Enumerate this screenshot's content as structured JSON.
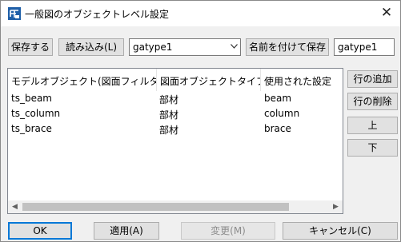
{
  "window": {
    "title": "一般図のオブジェクトレベル設定",
    "close_label": "✕",
    "app_icon": "tekla-app-icon"
  },
  "toolbar": {
    "save_label": "保存する",
    "load_label": "読み込み(L)",
    "preset_select_value": "gatype1",
    "save_as_label": "名前を付けて保存",
    "save_as_name_value": "gatype1"
  },
  "table": {
    "columns": [
      "モデルオブジェクト(図面フィルター)",
      "図面オブジェクトタイプ",
      "使用された設定"
    ],
    "rows": [
      [
        "ts_beam",
        "部材",
        "beam"
      ],
      [
        "ts_column",
        "部材",
        "column"
      ],
      [
        "ts_brace",
        "部材",
        "brace"
      ]
    ]
  },
  "side_buttons": {
    "add_row": "行の追加",
    "delete_row": "行の削除",
    "up": "上",
    "down": "下"
  },
  "footer": {
    "ok": "OK",
    "apply": "適用(A)",
    "modify": "変更(M)",
    "cancel": "キャンセル(C)"
  }
}
